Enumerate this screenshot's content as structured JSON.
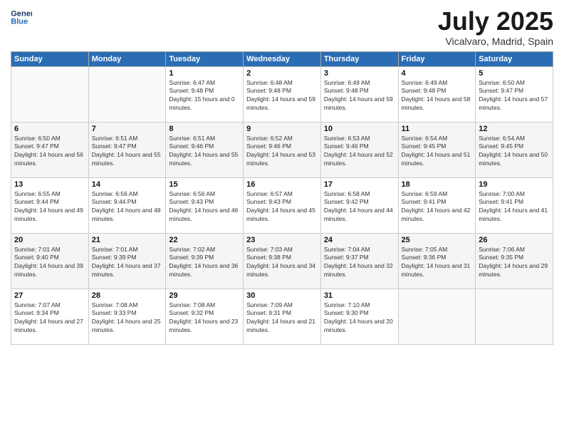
{
  "logo": {
    "line1": "General",
    "line2": "Blue"
  },
  "title": "July 2025",
  "location": "Vicalvaro, Madrid, Spain",
  "days_header": [
    "Sunday",
    "Monday",
    "Tuesday",
    "Wednesday",
    "Thursday",
    "Friday",
    "Saturday"
  ],
  "weeks": [
    [
      {
        "num": "",
        "sunrise": "",
        "sunset": "",
        "daylight": ""
      },
      {
        "num": "",
        "sunrise": "",
        "sunset": "",
        "daylight": ""
      },
      {
        "num": "1",
        "sunrise": "Sunrise: 6:47 AM",
        "sunset": "Sunset: 9:48 PM",
        "daylight": "Daylight: 15 hours and 0 minutes."
      },
      {
        "num": "2",
        "sunrise": "Sunrise: 6:48 AM",
        "sunset": "Sunset: 9:48 PM",
        "daylight": "Daylight: 14 hours and 59 minutes."
      },
      {
        "num": "3",
        "sunrise": "Sunrise: 6:49 AM",
        "sunset": "Sunset: 9:48 PM",
        "daylight": "Daylight: 14 hours and 59 minutes."
      },
      {
        "num": "4",
        "sunrise": "Sunrise: 6:49 AM",
        "sunset": "Sunset: 9:48 PM",
        "daylight": "Daylight: 14 hours and 58 minutes."
      },
      {
        "num": "5",
        "sunrise": "Sunrise: 6:50 AM",
        "sunset": "Sunset: 9:47 PM",
        "daylight": "Daylight: 14 hours and 57 minutes."
      }
    ],
    [
      {
        "num": "6",
        "sunrise": "Sunrise: 6:50 AM",
        "sunset": "Sunset: 9:47 PM",
        "daylight": "Daylight: 14 hours and 56 minutes."
      },
      {
        "num": "7",
        "sunrise": "Sunrise: 6:51 AM",
        "sunset": "Sunset: 9:47 PM",
        "daylight": "Daylight: 14 hours and 55 minutes."
      },
      {
        "num": "8",
        "sunrise": "Sunrise: 6:51 AM",
        "sunset": "Sunset: 9:46 PM",
        "daylight": "Daylight: 14 hours and 55 minutes."
      },
      {
        "num": "9",
        "sunrise": "Sunrise: 6:52 AM",
        "sunset": "Sunset: 9:46 PM",
        "daylight": "Daylight: 14 hours and 53 minutes."
      },
      {
        "num": "10",
        "sunrise": "Sunrise: 6:53 AM",
        "sunset": "Sunset: 9:46 PM",
        "daylight": "Daylight: 14 hours and 52 minutes."
      },
      {
        "num": "11",
        "sunrise": "Sunrise: 6:54 AM",
        "sunset": "Sunset: 9:45 PM",
        "daylight": "Daylight: 14 hours and 51 minutes."
      },
      {
        "num": "12",
        "sunrise": "Sunrise: 6:54 AM",
        "sunset": "Sunset: 9:45 PM",
        "daylight": "Daylight: 14 hours and 50 minutes."
      }
    ],
    [
      {
        "num": "13",
        "sunrise": "Sunrise: 6:55 AM",
        "sunset": "Sunset: 9:44 PM",
        "daylight": "Daylight: 14 hours and 49 minutes."
      },
      {
        "num": "14",
        "sunrise": "Sunrise: 6:56 AM",
        "sunset": "Sunset: 9:44 PM",
        "daylight": "Daylight: 14 hours and 48 minutes."
      },
      {
        "num": "15",
        "sunrise": "Sunrise: 6:56 AM",
        "sunset": "Sunset: 9:43 PM",
        "daylight": "Daylight: 14 hours and 46 minutes."
      },
      {
        "num": "16",
        "sunrise": "Sunrise: 6:57 AM",
        "sunset": "Sunset: 9:43 PM",
        "daylight": "Daylight: 14 hours and 45 minutes."
      },
      {
        "num": "17",
        "sunrise": "Sunrise: 6:58 AM",
        "sunset": "Sunset: 9:42 PM",
        "daylight": "Daylight: 14 hours and 44 minutes."
      },
      {
        "num": "18",
        "sunrise": "Sunrise: 6:59 AM",
        "sunset": "Sunset: 9:41 PM",
        "daylight": "Daylight: 14 hours and 42 minutes."
      },
      {
        "num": "19",
        "sunrise": "Sunrise: 7:00 AM",
        "sunset": "Sunset: 9:41 PM",
        "daylight": "Daylight: 14 hours and 41 minutes."
      }
    ],
    [
      {
        "num": "20",
        "sunrise": "Sunrise: 7:01 AM",
        "sunset": "Sunset: 9:40 PM",
        "daylight": "Daylight: 14 hours and 39 minutes."
      },
      {
        "num": "21",
        "sunrise": "Sunrise: 7:01 AM",
        "sunset": "Sunset: 9:39 PM",
        "daylight": "Daylight: 14 hours and 37 minutes."
      },
      {
        "num": "22",
        "sunrise": "Sunrise: 7:02 AM",
        "sunset": "Sunset: 9:39 PM",
        "daylight": "Daylight: 14 hours and 36 minutes."
      },
      {
        "num": "23",
        "sunrise": "Sunrise: 7:03 AM",
        "sunset": "Sunset: 9:38 PM",
        "daylight": "Daylight: 14 hours and 34 minutes."
      },
      {
        "num": "24",
        "sunrise": "Sunrise: 7:04 AM",
        "sunset": "Sunset: 9:37 PM",
        "daylight": "Daylight: 14 hours and 32 minutes."
      },
      {
        "num": "25",
        "sunrise": "Sunrise: 7:05 AM",
        "sunset": "Sunset: 9:36 PM",
        "daylight": "Daylight: 14 hours and 31 minutes."
      },
      {
        "num": "26",
        "sunrise": "Sunrise: 7:06 AM",
        "sunset": "Sunset: 9:35 PM",
        "daylight": "Daylight: 14 hours and 29 minutes."
      }
    ],
    [
      {
        "num": "27",
        "sunrise": "Sunrise: 7:07 AM",
        "sunset": "Sunset: 9:34 PM",
        "daylight": "Daylight: 14 hours and 27 minutes."
      },
      {
        "num": "28",
        "sunrise": "Sunrise: 7:08 AM",
        "sunset": "Sunset: 9:33 PM",
        "daylight": "Daylight: 14 hours and 25 minutes."
      },
      {
        "num": "29",
        "sunrise": "Sunrise: 7:08 AM",
        "sunset": "Sunset: 9:32 PM",
        "daylight": "Daylight: 14 hours and 23 minutes."
      },
      {
        "num": "30",
        "sunrise": "Sunrise: 7:09 AM",
        "sunset": "Sunset: 9:31 PM",
        "daylight": "Daylight: 14 hours and 21 minutes."
      },
      {
        "num": "31",
        "sunrise": "Sunrise: 7:10 AM",
        "sunset": "Sunset: 9:30 PM",
        "daylight": "Daylight: 14 hours and 20 minutes."
      },
      {
        "num": "",
        "sunrise": "",
        "sunset": "",
        "daylight": ""
      },
      {
        "num": "",
        "sunrise": "",
        "sunset": "",
        "daylight": ""
      }
    ]
  ]
}
